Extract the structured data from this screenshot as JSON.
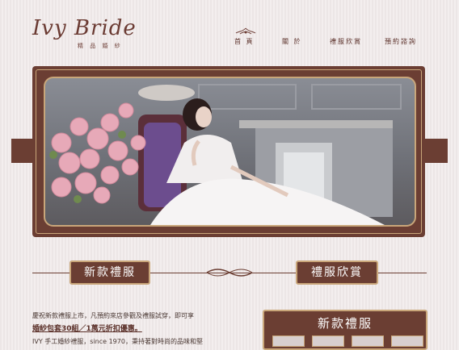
{
  "header": {
    "logo_script": "Ivy Bride",
    "logo_sub": "精 品 婚 紗",
    "nav": [
      {
        "label": "首 頁"
      },
      {
        "label": "關 於"
      },
      {
        "label": "禮服欣賞"
      },
      {
        "label": "預約諮詢"
      }
    ]
  },
  "sections": {
    "new_gowns": "新款禮服",
    "gallery": "禮服欣賞"
  },
  "content": {
    "intro": "慶祝新款禮服上市，凡預約來店參觀及禮服試穿，即可享",
    "promo": "婚紗包套30組／1萬元折扣優惠。",
    "footer_line": "IVY 手工婚紗禮服，since 1970，秉持著對時尚的品味和堅"
  },
  "sidebar": {
    "title": "新款禮服"
  },
  "colors": {
    "brand": "#6b3e33",
    "gold": "#c9a67a",
    "background": "#f0eaea"
  }
}
